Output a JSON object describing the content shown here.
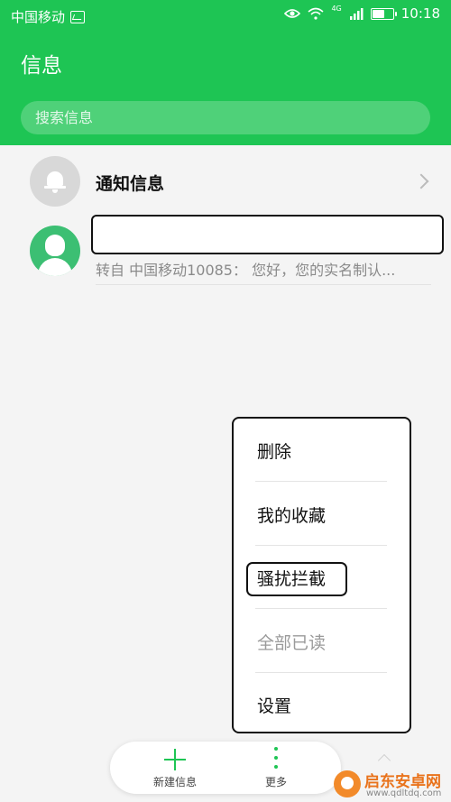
{
  "status_bar": {
    "carrier": "中国移动",
    "network": "4G",
    "time": "10:18"
  },
  "header": {
    "title": "信息",
    "search_placeholder": "搜索信息"
  },
  "conversations": [
    {
      "title": "通知信息",
      "icon": "bell-icon"
    },
    {
      "title": "",
      "preview": "转自 中国移动10085： 您好，您的实名制认...",
      "icon": "person-icon"
    }
  ],
  "popup_menu": {
    "items": [
      {
        "label": "删除",
        "disabled": false
      },
      {
        "label": "我的收藏",
        "disabled": false
      },
      {
        "label": "骚扰拦截",
        "disabled": false,
        "highlighted": true
      },
      {
        "label": "全部已读",
        "disabled": true
      },
      {
        "label": "设置",
        "disabled": false
      }
    ]
  },
  "bottom_bar": {
    "new_label": "新建信息",
    "more_label": "更多"
  },
  "watermark": {
    "title": "启东安卓网",
    "url": "www.qdltdq.com"
  },
  "colors": {
    "accent": "#1ec554",
    "avatar_person": "#3cbf73",
    "avatar_bell": "#d8d8d8"
  }
}
